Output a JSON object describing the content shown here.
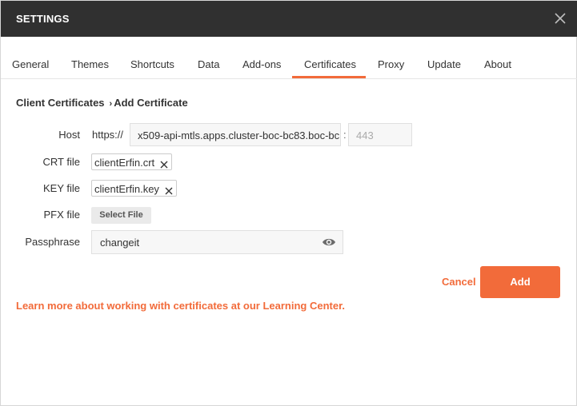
{
  "window": {
    "title": "SETTINGS"
  },
  "tabs": [
    {
      "label": "General"
    },
    {
      "label": "Themes"
    },
    {
      "label": "Shortcuts"
    },
    {
      "label": "Data"
    },
    {
      "label": "Add-ons"
    },
    {
      "label": "Certificates",
      "active": true
    },
    {
      "label": "Proxy"
    },
    {
      "label": "Update"
    },
    {
      "label": "About"
    }
  ],
  "breadcrumb": {
    "parent": "Client Certificates",
    "separator": "›",
    "current": "Add Certificate"
  },
  "form": {
    "host": {
      "label": "Host",
      "prefix": "https://",
      "value": "x509-api-mtls.apps.cluster-boc-bc83.boc-bc",
      "colon": ":",
      "port_placeholder": "443"
    },
    "crt": {
      "label": "CRT file",
      "file_name": "clientErfin.crt"
    },
    "key": {
      "label": "KEY file",
      "file_name": "clientErfin.key"
    },
    "pfx": {
      "label": "PFX file",
      "button_label": "Select File"
    },
    "passphrase": {
      "label": "Passphrase",
      "value": "changeit"
    }
  },
  "actions": {
    "cancel_label": "Cancel",
    "add_label": "Add"
  },
  "footer": {
    "learn_link": "Learn more about working with certificates at our Learning Center."
  },
  "colors": {
    "accent": "#f26b3a",
    "title_bar": "#303030"
  },
  "icons": {
    "close": "close-icon",
    "chip_remove": "close-icon",
    "visibility": "eye-icon"
  }
}
